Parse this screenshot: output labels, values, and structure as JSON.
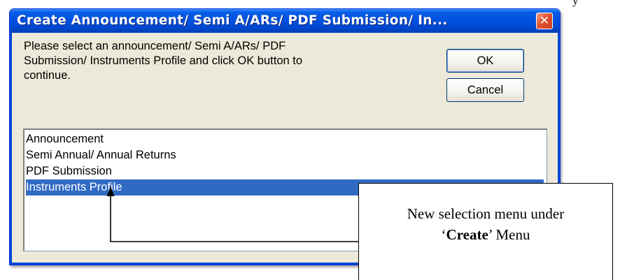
{
  "clipped_text": "y",
  "dialog": {
    "title": "Create Announcement/ Semi A/ARs/ PDF Submission/ In...",
    "close_icon": "close-icon",
    "instructions": "Please select an announcement/ Semi A/ARs/ PDF Submission/ Instruments Profile and click OK button to continue.",
    "ok_label": "OK",
    "cancel_label": "Cancel",
    "list_items": [
      "Announcement",
      "Semi Annual/ Annual Returns",
      "PDF Submission",
      "Instruments Profile"
    ],
    "selected_index": 3,
    "colors": {
      "title_bar": "#0054e3",
      "selection": "#316ac5",
      "close_button": "#e2542f",
      "dialog_bg": "#ece9d8"
    }
  },
  "callout": {
    "line1": "New selection menu under",
    "line2_quote_open": "‘",
    "line2_bold": "Create",
    "line2_quote_close": "’",
    "line2_rest": " Menu"
  }
}
